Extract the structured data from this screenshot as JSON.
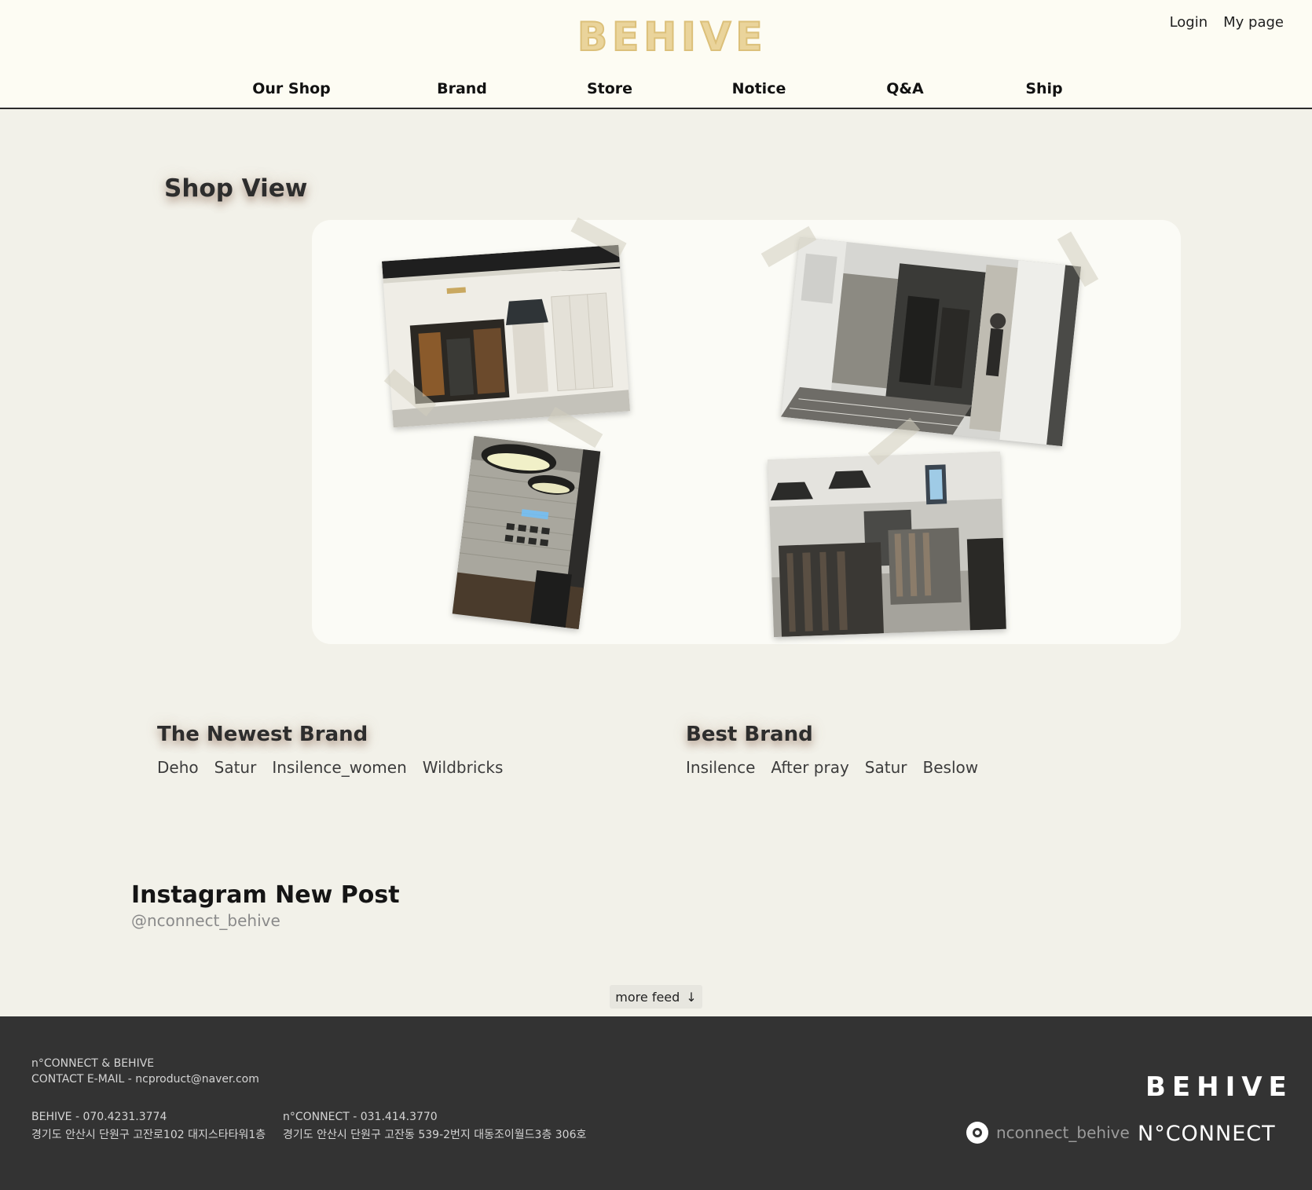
{
  "header": {
    "logo": "BEHIVE",
    "login": "Login",
    "mypage": "My page",
    "nav": [
      "Our Shop",
      "Brand",
      "Store",
      "Notice",
      "Q&A",
      "Ship"
    ]
  },
  "shop_view": {
    "title": "Shop View"
  },
  "newest_brand": {
    "title": "The Newest Brand",
    "items": [
      "Deho",
      "Satur",
      "Insilence_women",
      "Wildbricks"
    ]
  },
  "best_brand": {
    "title": "Best Brand",
    "items": [
      "Insilence",
      "After pray",
      "Satur",
      "Beslow"
    ]
  },
  "instagram": {
    "title": "Instagram New Post",
    "handle": "@nconnect_behive",
    "more_feed": "more feed",
    "more_arrow": "↓"
  },
  "footer": {
    "company": "n°CONNECT & BEHIVE",
    "contact": "CONTACT E-MAIL - ncproduct@naver.com",
    "behive_phone": "BEHIVE - 070.4231.3774",
    "behive_addr": "경기도 안산시 단원구 고잔로102 대지스타타워1층",
    "nconnect_phone": "n°CONNECT - 031.414.3770",
    "nconnect_addr": "경기도 안산시 단원구 고잔동 539-2번지 대동조이월드3층 306호",
    "logo": "BEHIVE",
    "insta_handle": "nconnect_behive",
    "nconnect_logo": "N°CONNECT"
  },
  "colors": {
    "background": "#f2f1e9",
    "header_bg": "#fdfcf3",
    "logo": "#ead49b",
    "footer_bg": "#333333"
  }
}
